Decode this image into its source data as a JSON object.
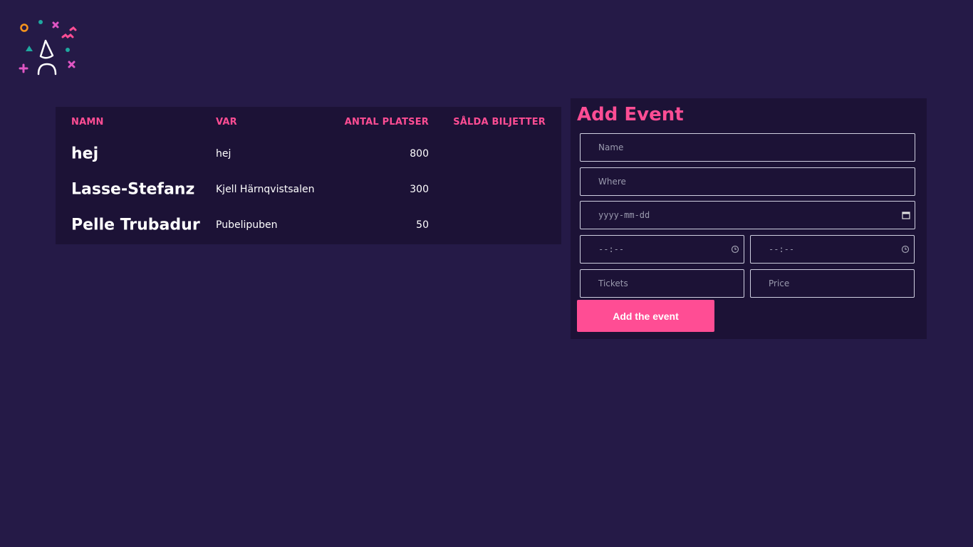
{
  "table": {
    "headers": {
      "name": "NAMN",
      "where": "VAR",
      "seats": "ANTAL PLATSER",
      "sold": "SÅLDA BILJETTER"
    },
    "rows": [
      {
        "name": "hej",
        "where": "hej",
        "seats": "800",
        "sold": ""
      },
      {
        "name": "Lasse-Stefanz",
        "where": "Kjell Härnqvistsalen",
        "seats": "300",
        "sold": ""
      },
      {
        "name": "Pelle Trubadur",
        "where": "Pubelipuben",
        "seats": "50",
        "sold": ""
      }
    ]
  },
  "form": {
    "title": "Add Event",
    "name_placeholder": "Name",
    "where_placeholder": "Where",
    "date_placeholder": "yyyy-mm-dd",
    "time_start_placeholder": "--:--",
    "time_end_placeholder": "--:--",
    "tickets_placeholder": "Tickets",
    "price_placeholder": "Price",
    "submit_label": "Add the event"
  },
  "colors": {
    "background": "#251a47",
    "panel": "#1c1236",
    "accent": "#ff4d94"
  },
  "icons": {
    "logo": "party-person-logo",
    "date": "calendar-icon",
    "time": "clock-icon"
  }
}
